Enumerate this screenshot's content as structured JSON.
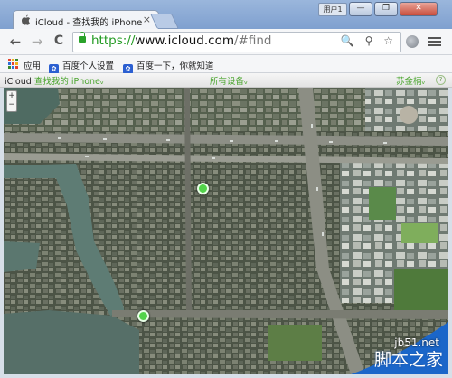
{
  "browser": {
    "tab_title": "iCloud - 查找我的 iPhone",
    "tab_close": "×",
    "user_label": "用户1",
    "window_buttons": {
      "minimize": "—",
      "restore": "❐",
      "close": "✕"
    }
  },
  "toolbar": {
    "back": "←",
    "forward": "→",
    "reload": "C",
    "url_scheme": "https://",
    "url_host": "www.icloud.com",
    "url_path": "/#find",
    "omnibox_icons": "🔍 ⚲ ☆"
  },
  "bookmarks": [
    {
      "label": "应用",
      "icon": "apps-icon"
    },
    {
      "label": "百度个人设置",
      "icon": "baidu-paw-icon"
    },
    {
      "label": "百度一下，你就知道",
      "icon": "baidu-paw-icon"
    }
  ],
  "icloud_bar": {
    "brand": "iCloud",
    "app_name": "查找我的 iPhone",
    "devices": "所有设备",
    "user": "苏金柄",
    "help": "?"
  },
  "map": {
    "zoom_in": "+",
    "zoom_out": "−",
    "device_pins": 2
  },
  "watermark": {
    "site": "jb51.net",
    "text": "脚本之家"
  },
  "colors": {
    "accent_green": "#4aa52e",
    "secure_green": "#219a21",
    "pin_green": "#52d34a"
  }
}
